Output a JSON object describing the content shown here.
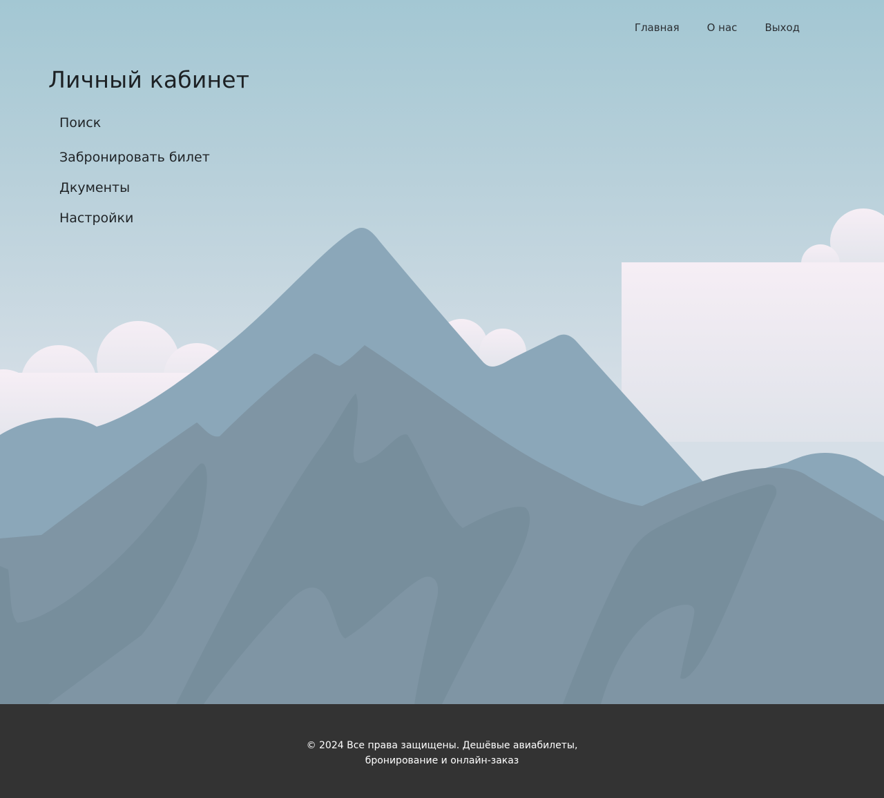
{
  "header": {
    "nav": [
      {
        "label": "Главная"
      },
      {
        "label": "О нас"
      },
      {
        "label": "Выход"
      }
    ]
  },
  "main": {
    "title": "Личный кабинет",
    "menu": [
      {
        "label": "Поиск"
      },
      {
        "label": "Забронировать билет"
      },
      {
        "label": "Дкументы"
      },
      {
        "label": "Настройки"
      }
    ]
  },
  "footer": {
    "line1": "© 2024 Все права защищены. Дешёвые авиабилеты,",
    "line2": "бронирование и онлайн-заказ"
  },
  "colors": {
    "sky_top": "#a3c7d3",
    "sky_bottom": "#dde3ea",
    "cloud": "#efe9f0",
    "mountain_back": "#8ba7b9",
    "mountain_front": "#7f95a4",
    "mountain_shadow": "#778e9c",
    "footer_bg": "#333333",
    "footer_text": "#ffffff"
  }
}
